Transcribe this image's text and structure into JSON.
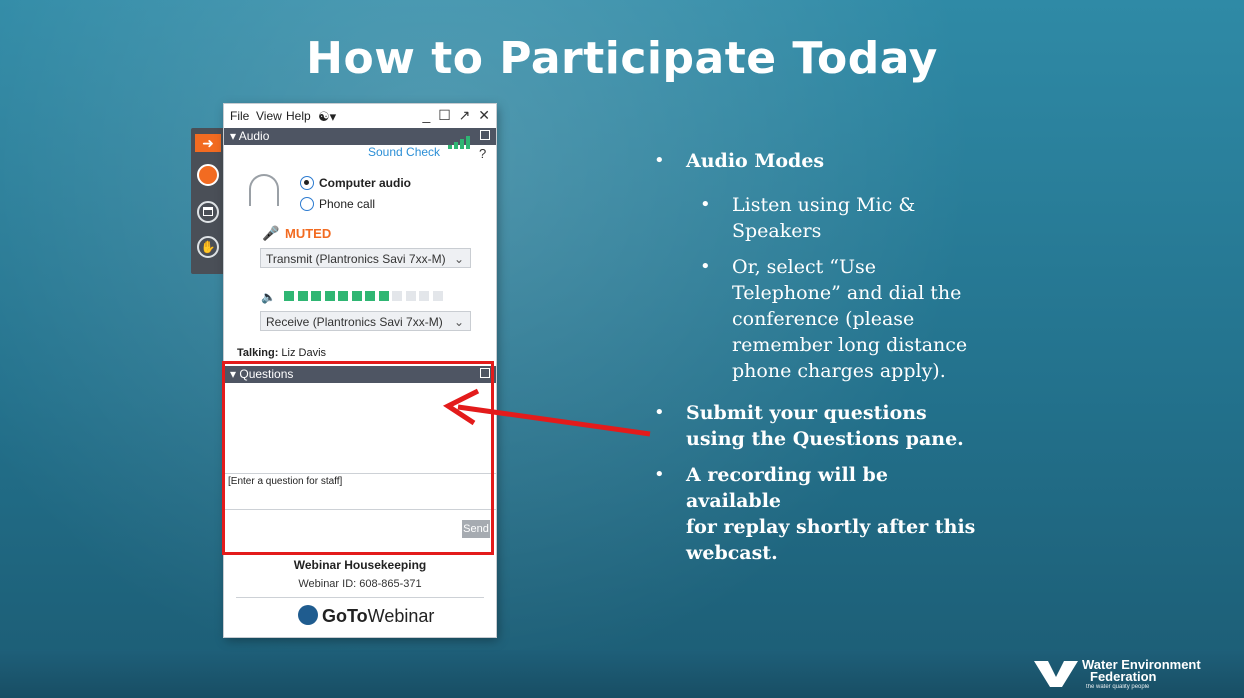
{
  "slide": {
    "title": "How to Participate Today"
  },
  "panel": {
    "menu": {
      "file": "File",
      "view": "View",
      "help": "Help",
      "globe_icon": "globe-icon"
    },
    "window_controls": "_ ☐ ↗ ✕",
    "audio": {
      "section_label": "Audio",
      "sound_check": "Sound Check",
      "help": "?",
      "mode_options": [
        "Computer audio",
        "Phone call"
      ],
      "selected_mode": "Computer audio",
      "mute_status": "MUTED",
      "transmit_device": "Transmit (Plantronics Savi 7xx-M)",
      "receive_device": "Receive (Plantronics Savi 7xx-M)",
      "speaker_level": {
        "active": 8,
        "total": 12
      },
      "talking_label": "Talking:",
      "talking_name": "Liz Davis"
    },
    "questions": {
      "section_label": "Questions",
      "input_placeholder": "[Enter a question for staff]",
      "send_label": "Send"
    },
    "housekeeping_title": "Webinar Housekeeping",
    "webinar_id": "Webinar ID: 608-865-371",
    "brand_bold": "GoTo",
    "brand_regular": "Webinar"
  },
  "bullets": [
    {
      "level": 1,
      "lines": [
        "Audio Modes"
      ]
    },
    {
      "level": 2,
      "lines": [
        "Listen using Mic &",
        "Speakers"
      ]
    },
    {
      "level": 2,
      "lines": [
        "Or, select “Use",
        "Telephone” and dial the",
        "conference (please",
        "remember long distance",
        "phone charges apply)."
      ]
    },
    {
      "level": 1,
      "lines": [
        "Submit your questions",
        "using the Questions pane."
      ]
    },
    {
      "level": 1,
      "lines": [
        "A recording will be",
        "available",
        "for replay shortly after this",
        "webcast."
      ]
    }
  ],
  "logo": {
    "line1": "Water Environment",
    "line2": "Federation",
    "tagline": "the water quality people"
  },
  "colors": {
    "background": "#2a7f9c",
    "accent_orange": "#f26b21",
    "highlight_red": "#e31b1b",
    "section_header": "#4e5563",
    "level_green": "#2fb673"
  }
}
